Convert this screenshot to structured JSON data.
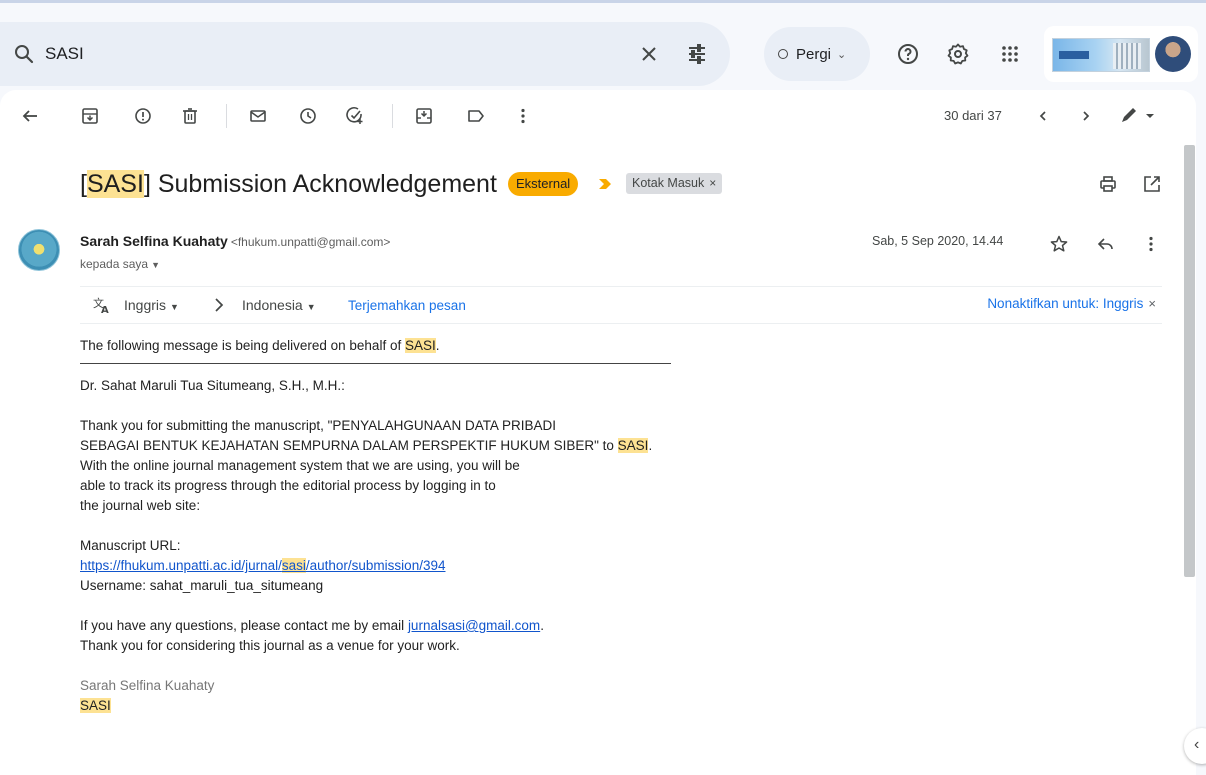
{
  "search": {
    "query": "SASI"
  },
  "header": {
    "status_label": "Pergi",
    "status_chevron": "⌄"
  },
  "toolbar": {
    "counter": "30 dari 37"
  },
  "email": {
    "subject_prefix": "[",
    "subject_highlight": "SASI",
    "subject_rest": "] Submission Acknowledgement",
    "chip_external": "Eksternal",
    "chip_inbox": "Kotak Masuk",
    "chip_close": "×",
    "sender_name": "Sarah Selfina Kuahaty",
    "sender_email": "<fhukum.unpatti@gmail.com>",
    "to_line": "kepada saya",
    "date": "Sab, 5 Sep 2020, 14.44"
  },
  "translate": {
    "from_lang": "Inggris",
    "to_lang": "Indonesia",
    "translate_link": "Terjemahkan pesan",
    "disable_link": "Nonaktifkan untuk: Inggris",
    "close": "×"
  },
  "body": {
    "l1_pre": "The following message is being delivered on behalf of ",
    "l1_hl": "SASI",
    "l1_post": ".",
    "salutation": "Dr. Sahat Maruli Tua Situmeang, S.H., M.H.:",
    "p1_l1": "Thank you for submitting the manuscript, \"PENYALAHGUNAAN DATA PRIBADI",
    "p1_l2_pre": "SEBAGAI BENTUK KEJAHATAN SEMPURNA DALAM PERSPEKTIF HUKUM SIBER\" to ",
    "p1_l2_hl": "SASI",
    "p1_l2_post": ".",
    "p1_l3": "With the online journal management system that we are using, you will be",
    "p1_l4": "able to track its progress through the editorial process by logging in to",
    "p1_l5": "the journal web site:",
    "url_label": "Manuscript URL:",
    "url_pre": "https://fhukum.unpatti.ac.id/jurnal/",
    "url_hl": "sasi",
    "url_post": "/author/submission/394",
    "username": "Username: sahat_maruli_tua_situmeang",
    "contact_pre": "If you have any questions, please contact me by email ",
    "contact_email": "jurnalsasi@gmail.com",
    "contact_post": ".",
    "thanks": "Thank you for considering this journal as a venue for your work.",
    "sig_name": "Sarah Selfina Kuahaty",
    "sig_org": "SASI"
  },
  "colors": {
    "accent": "#1a73e8",
    "highlight": "#fde293",
    "external_chip": "#f9ab00"
  }
}
